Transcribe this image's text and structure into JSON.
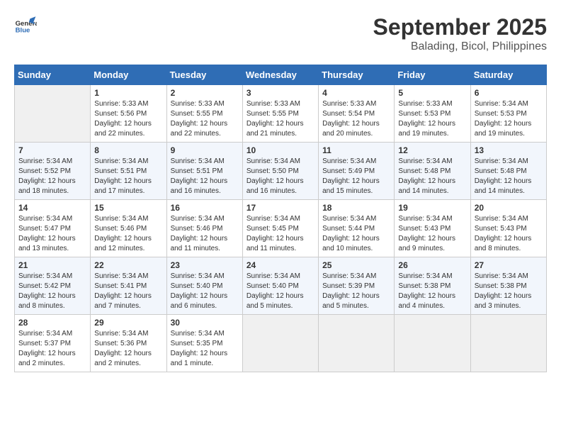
{
  "header": {
    "logo_line1": "General",
    "logo_line2": "Blue",
    "month": "September 2025",
    "location": "Balading, Bicol, Philippines"
  },
  "days_of_week": [
    "Sunday",
    "Monday",
    "Tuesday",
    "Wednesday",
    "Thursday",
    "Friday",
    "Saturday"
  ],
  "weeks": [
    [
      {
        "day": "",
        "empty": true
      },
      {
        "day": "1",
        "sunrise": "Sunrise: 5:33 AM",
        "sunset": "Sunset: 5:56 PM",
        "daylight": "Daylight: 12 hours and 22 minutes."
      },
      {
        "day": "2",
        "sunrise": "Sunrise: 5:33 AM",
        "sunset": "Sunset: 5:55 PM",
        "daylight": "Daylight: 12 hours and 22 minutes."
      },
      {
        "day": "3",
        "sunrise": "Sunrise: 5:33 AM",
        "sunset": "Sunset: 5:55 PM",
        "daylight": "Daylight: 12 hours and 21 minutes."
      },
      {
        "day": "4",
        "sunrise": "Sunrise: 5:33 AM",
        "sunset": "Sunset: 5:54 PM",
        "daylight": "Daylight: 12 hours and 20 minutes."
      },
      {
        "day": "5",
        "sunrise": "Sunrise: 5:33 AM",
        "sunset": "Sunset: 5:53 PM",
        "daylight": "Daylight: 12 hours and 19 minutes."
      },
      {
        "day": "6",
        "sunrise": "Sunrise: 5:34 AM",
        "sunset": "Sunset: 5:53 PM",
        "daylight": "Daylight: 12 hours and 19 minutes."
      }
    ],
    [
      {
        "day": "7",
        "sunrise": "Sunrise: 5:34 AM",
        "sunset": "Sunset: 5:52 PM",
        "daylight": "Daylight: 12 hours and 18 minutes."
      },
      {
        "day": "8",
        "sunrise": "Sunrise: 5:34 AM",
        "sunset": "Sunset: 5:51 PM",
        "daylight": "Daylight: 12 hours and 17 minutes."
      },
      {
        "day": "9",
        "sunrise": "Sunrise: 5:34 AM",
        "sunset": "Sunset: 5:51 PM",
        "daylight": "Daylight: 12 hours and 16 minutes."
      },
      {
        "day": "10",
        "sunrise": "Sunrise: 5:34 AM",
        "sunset": "Sunset: 5:50 PM",
        "daylight": "Daylight: 12 hours and 16 minutes."
      },
      {
        "day": "11",
        "sunrise": "Sunrise: 5:34 AM",
        "sunset": "Sunset: 5:49 PM",
        "daylight": "Daylight: 12 hours and 15 minutes."
      },
      {
        "day": "12",
        "sunrise": "Sunrise: 5:34 AM",
        "sunset": "Sunset: 5:48 PM",
        "daylight": "Daylight: 12 hours and 14 minutes."
      },
      {
        "day": "13",
        "sunrise": "Sunrise: 5:34 AM",
        "sunset": "Sunset: 5:48 PM",
        "daylight": "Daylight: 12 hours and 14 minutes."
      }
    ],
    [
      {
        "day": "14",
        "sunrise": "Sunrise: 5:34 AM",
        "sunset": "Sunset: 5:47 PM",
        "daylight": "Daylight: 12 hours and 13 minutes."
      },
      {
        "day": "15",
        "sunrise": "Sunrise: 5:34 AM",
        "sunset": "Sunset: 5:46 PM",
        "daylight": "Daylight: 12 hours and 12 minutes."
      },
      {
        "day": "16",
        "sunrise": "Sunrise: 5:34 AM",
        "sunset": "Sunset: 5:46 PM",
        "daylight": "Daylight: 12 hours and 11 minutes."
      },
      {
        "day": "17",
        "sunrise": "Sunrise: 5:34 AM",
        "sunset": "Sunset: 5:45 PM",
        "daylight": "Daylight: 12 hours and 11 minutes."
      },
      {
        "day": "18",
        "sunrise": "Sunrise: 5:34 AM",
        "sunset": "Sunset: 5:44 PM",
        "daylight": "Daylight: 12 hours and 10 minutes."
      },
      {
        "day": "19",
        "sunrise": "Sunrise: 5:34 AM",
        "sunset": "Sunset: 5:43 PM",
        "daylight": "Daylight: 12 hours and 9 minutes."
      },
      {
        "day": "20",
        "sunrise": "Sunrise: 5:34 AM",
        "sunset": "Sunset: 5:43 PM",
        "daylight": "Daylight: 12 hours and 8 minutes."
      }
    ],
    [
      {
        "day": "21",
        "sunrise": "Sunrise: 5:34 AM",
        "sunset": "Sunset: 5:42 PM",
        "daylight": "Daylight: 12 hours and 8 minutes."
      },
      {
        "day": "22",
        "sunrise": "Sunrise: 5:34 AM",
        "sunset": "Sunset: 5:41 PM",
        "daylight": "Daylight: 12 hours and 7 minutes."
      },
      {
        "day": "23",
        "sunrise": "Sunrise: 5:34 AM",
        "sunset": "Sunset: 5:40 PM",
        "daylight": "Daylight: 12 hours and 6 minutes."
      },
      {
        "day": "24",
        "sunrise": "Sunrise: 5:34 AM",
        "sunset": "Sunset: 5:40 PM",
        "daylight": "Daylight: 12 hours and 5 minutes."
      },
      {
        "day": "25",
        "sunrise": "Sunrise: 5:34 AM",
        "sunset": "Sunset: 5:39 PM",
        "daylight": "Daylight: 12 hours and 5 minutes."
      },
      {
        "day": "26",
        "sunrise": "Sunrise: 5:34 AM",
        "sunset": "Sunset: 5:38 PM",
        "daylight": "Daylight: 12 hours and 4 minutes."
      },
      {
        "day": "27",
        "sunrise": "Sunrise: 5:34 AM",
        "sunset": "Sunset: 5:38 PM",
        "daylight": "Daylight: 12 hours and 3 minutes."
      }
    ],
    [
      {
        "day": "28",
        "sunrise": "Sunrise: 5:34 AM",
        "sunset": "Sunset: 5:37 PM",
        "daylight": "Daylight: 12 hours and 2 minutes."
      },
      {
        "day": "29",
        "sunrise": "Sunrise: 5:34 AM",
        "sunset": "Sunset: 5:36 PM",
        "daylight": "Daylight: 12 hours and 2 minutes."
      },
      {
        "day": "30",
        "sunrise": "Sunrise: 5:34 AM",
        "sunset": "Sunset: 5:35 PM",
        "daylight": "Daylight: 12 hours and 1 minute."
      },
      {
        "day": "",
        "empty": true
      },
      {
        "day": "",
        "empty": true
      },
      {
        "day": "",
        "empty": true
      },
      {
        "day": "",
        "empty": true
      }
    ]
  ]
}
